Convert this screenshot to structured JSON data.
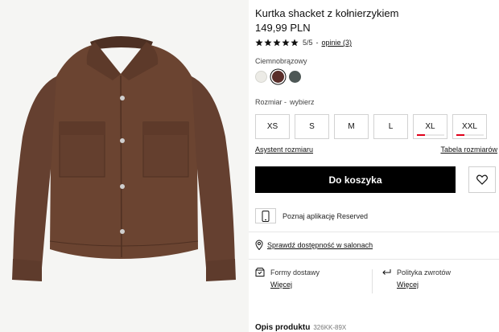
{
  "product": {
    "title": "Kurtka shacket z kołnierzykiem",
    "price": "149,99 PLN",
    "rating": {
      "stars": 5,
      "score_text": "5/5",
      "separator": "-",
      "reviews_link": "opinie (3)"
    }
  },
  "color": {
    "selected_name": "Ciemnobrązowy",
    "swatches": [
      {
        "name": "cream",
        "hex": "#ecebe6"
      },
      {
        "name": "dark-brown",
        "hex": "#5a2e2a"
      },
      {
        "name": "dark-green-grey",
        "hex": "#4e5856"
      }
    ]
  },
  "size": {
    "label": "Rozmiar -",
    "value": "wybierz",
    "options": [
      {
        "label": "XS",
        "low_stock": false
      },
      {
        "label": "S",
        "low_stock": false
      },
      {
        "label": "M",
        "low_stock": false
      },
      {
        "label": "L",
        "low_stock": false
      },
      {
        "label": "XL",
        "low_stock": true
      },
      {
        "label": "XXL",
        "low_stock": true
      }
    ],
    "assistant_link": "Asystent rozmiaru",
    "table_link": "Tabela rozmiarów"
  },
  "actions": {
    "add_to_cart": "Do koszyka",
    "wishlist_icon": "heart-icon"
  },
  "app_promo": "Poznaj aplikację Reserved",
  "stores_link": "Sprawdź dostępność w salonach",
  "delivery": {
    "title": "Formy dostawy",
    "more": "Więcej"
  },
  "returns": {
    "title": "Polityka zwrotów",
    "more": "Więcej"
  },
  "description": {
    "title": "Opis produktu",
    "code": "326KK-89X"
  },
  "colors": {
    "accent": "#000000",
    "low_stock": "#e0001a",
    "jacket": "#6b4431"
  }
}
